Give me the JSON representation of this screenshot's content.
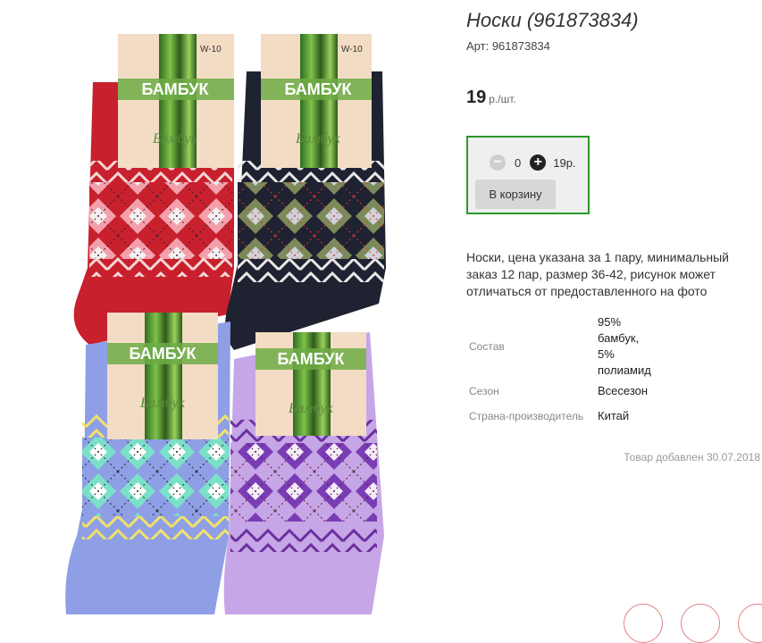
{
  "product": {
    "title": "Носки (961873834)",
    "sku_label": "Арт:",
    "sku_value": "961873834",
    "price": "19",
    "price_unit": "р./шт."
  },
  "cart": {
    "minus_icon": "minus-circle-icon",
    "plus_icon": "plus-circle-icon",
    "quantity": "0",
    "line_price": "19р.",
    "add_label": "В корзину",
    "border_color": "#2a9a2a"
  },
  "description": "Носки, цена указана за 1 пару, минимальный заказ 12 пар, размер 36-42, рисунок может отличаться от предоставленного на фото",
  "specs": {
    "composition_label": "Состав",
    "composition_lines": [
      "95%",
      "бамбук,",
      "5%",
      "полиамид"
    ],
    "season_label": "Сезон",
    "season_value": "Всесезон",
    "country_label": "Страна-производитель",
    "country_value": "Китай"
  },
  "added_date": "Товар добавлен 30.07.2018",
  "image": {
    "tag_brand": "БАМБУК",
    "tag_script": "Бамбук",
    "tag_size": "W-10",
    "sock_colors": [
      "#c8202c",
      "#1f2230",
      "#8e9fe6",
      "#c6a6e6"
    ]
  }
}
